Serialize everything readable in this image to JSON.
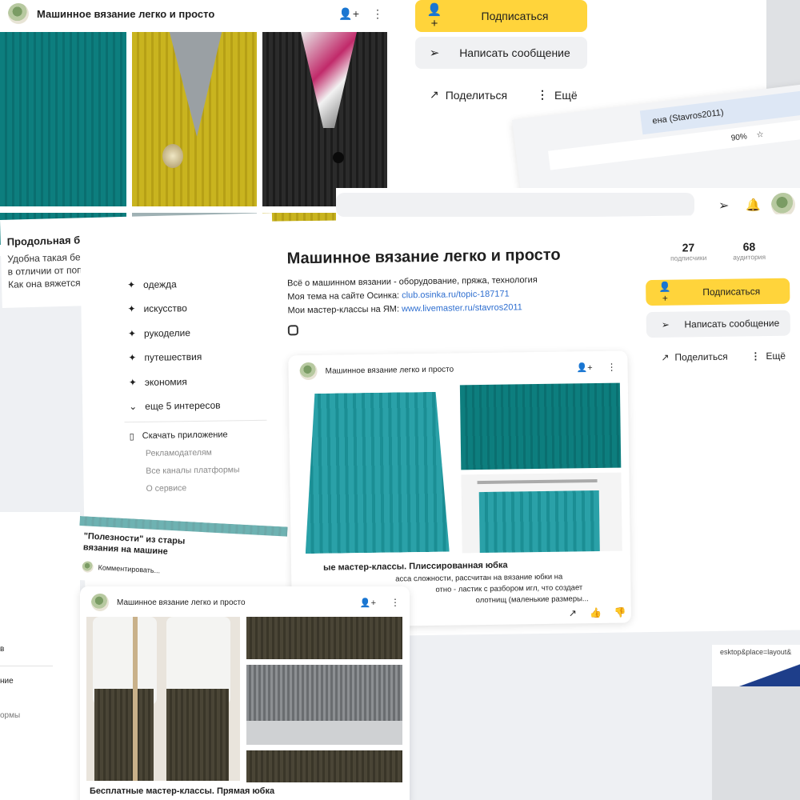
{
  "top_card": {
    "title": "Машинное вязание легко и просто",
    "article_title": "Продольная бейка ластиком для кардиганов",
    "lines": [
      "Удобна такая бейка тем, что её можно вяз",
      "в отличии от поперечных, разн",
      "Как она вяжется, как"
    ]
  },
  "top_actions": {
    "subscribe": "Подписаться",
    "message": "Написать сообщение",
    "share": "Поделиться",
    "more": "Ещё"
  },
  "browser": {
    "tab_title": "ена (Stavros2011)",
    "zoom": "90%",
    "url_fragment": "esktop&place=layout&"
  },
  "sidebar": {
    "interests": [
      "одежда",
      "искусство",
      "рукоделие",
      "путешествия",
      "экономия"
    ],
    "more_interests": "еще 5 интересов",
    "download_app": "Скачать приложение",
    "advertisers": "Рекламодателям",
    "all_channels": "Все каналы платформы",
    "about": "О сервисе"
  },
  "channel": {
    "name": "Машинное вязание легко и просто",
    "subscribers_count": "27",
    "subscribers_label": "подписчики",
    "audience_count": "68",
    "audience_label": "аудитория",
    "description": "Всё о машинном вязании - оборудование, пряжа, технология",
    "osinka_prefix": "Моя тема на сайте Осинка: ",
    "osinka_link": "club.osinka.ru/topic-187171",
    "ym_prefix": "Мои мастер-классы на ЯМ: ",
    "ym_link": "www.livemaster.ru/stavros2011",
    "subscribe": "Подписаться",
    "message": "Написать сообщение",
    "share": "Поделиться",
    "more": "Ещё"
  },
  "post_card": {
    "channel": "Машинное вязание легко и просто",
    "title": "ые мастер-классы. Плиссированная юбка",
    "lines": [
      "асса сложности, рассчитан на вязание юбки на",
      "отно - ластик с разбором игл, что создает",
      "олотнищ (маленькие размеры..."
    ]
  },
  "left_card": {
    "title_line1": "\"Полезности\" из стары",
    "title_line2": "вязания на машине",
    "comment": "Комментировать..."
  },
  "bottom_card": {
    "channel": "Машинное вязание легко и просто",
    "title": "Бесплатные мастер-классы. Прямая юбка"
  },
  "left_fragments": {
    "frag1": "в",
    "frag2": "ние",
    "frag3": "ормы"
  }
}
